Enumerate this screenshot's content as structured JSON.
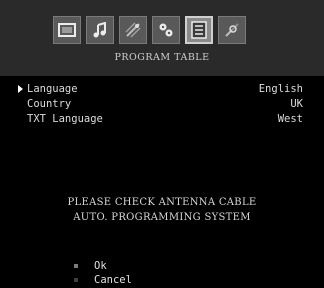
{
  "menu": {
    "title": "PROGRAM TABLE",
    "tabs": [
      {
        "icon": "picture-icon",
        "active": false
      },
      {
        "icon": "sound-icon",
        "active": false
      },
      {
        "icon": "features-icon",
        "active": false
      },
      {
        "icon": "install-icon",
        "active": false
      },
      {
        "icon": "program-table-icon",
        "active": true
      },
      {
        "icon": "source-icon",
        "active": false
      }
    ]
  },
  "settings": [
    {
      "label": "Language",
      "value": "English",
      "selected": true
    },
    {
      "label": "Country",
      "value": "UK",
      "selected": false
    },
    {
      "label": "TXT Language",
      "value": "West",
      "selected": false
    }
  ],
  "message": {
    "line1": "PLEASE CHECK ANTENNA CABLE",
    "line2": "AUTO. PROGRAMMING SYSTEM"
  },
  "options": [
    {
      "label": "Ok"
    },
    {
      "label": "Cancel"
    }
  ],
  "colors": {
    "background": "#000000",
    "header": "#2a2a2a",
    "text": "#d8d8d8"
  }
}
